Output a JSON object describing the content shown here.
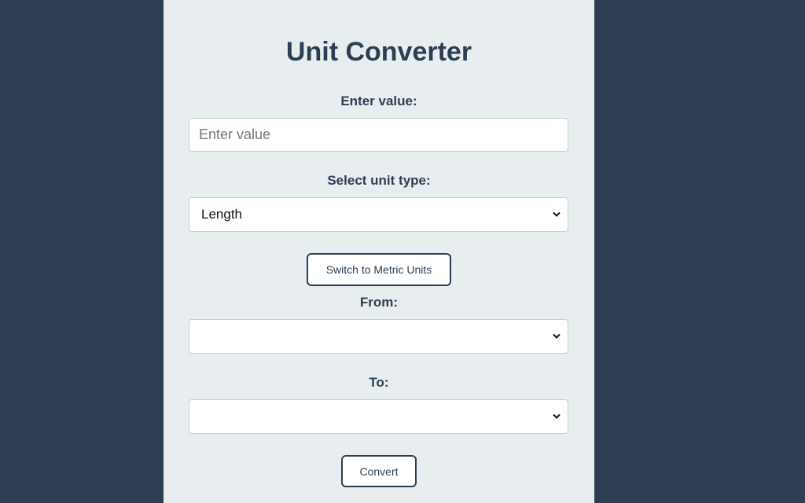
{
  "app": {
    "title": "Unit Converter"
  },
  "value_field": {
    "label": "Enter value:",
    "placeholder": "Enter value",
    "value": ""
  },
  "unit_type": {
    "label": "Select unit type:",
    "selected": "Length"
  },
  "switch_button": {
    "label": "Switch to Metric Units"
  },
  "from_field": {
    "label": "From:",
    "selected": ""
  },
  "to_field": {
    "label": "To:",
    "selected": ""
  },
  "convert_button": {
    "label": "Convert"
  },
  "colors": {
    "page_background": "#2e3e52",
    "card_background": "#e8eeef",
    "text_primary": "#2e3e52"
  },
  "icons": {
    "select_arrow": "chevron-down-icon"
  }
}
